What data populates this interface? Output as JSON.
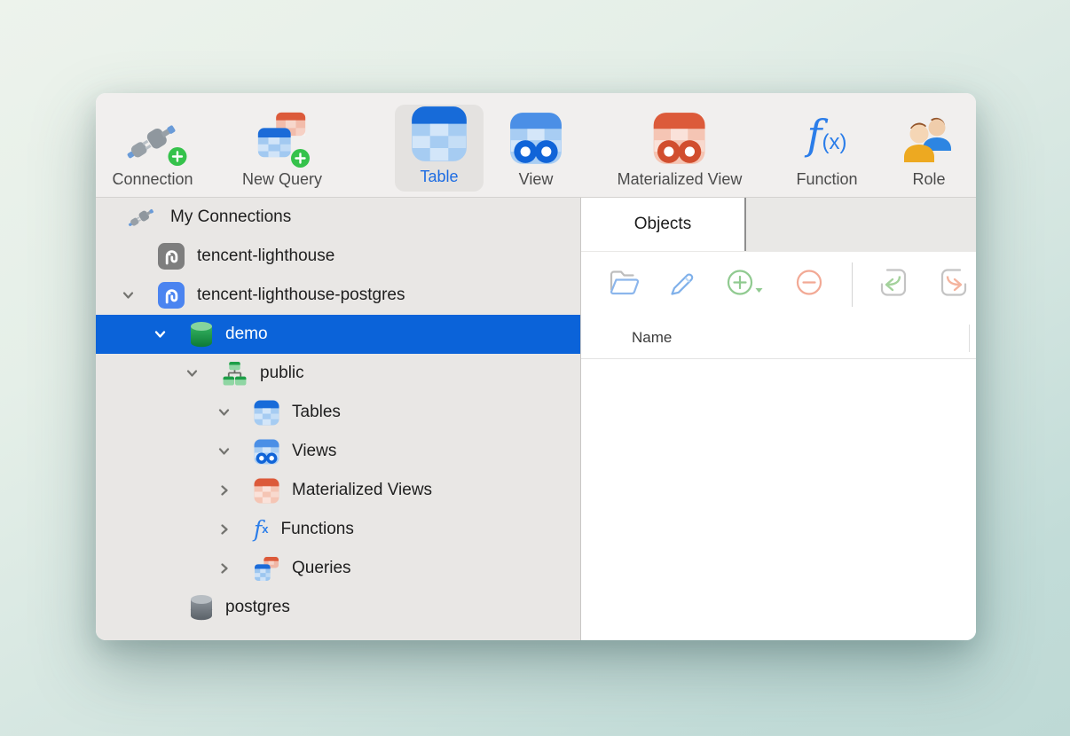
{
  "toolbar": {
    "items": [
      {
        "label": "Connection",
        "icon": "connection-plug-add"
      },
      {
        "label": "New Query",
        "icon": "new-query-add"
      },
      {
        "label": "Table",
        "icon": "table",
        "selected": true
      },
      {
        "label": "View",
        "icon": "view"
      },
      {
        "label": "Materialized View",
        "icon": "materialized-view"
      },
      {
        "label": "Function",
        "icon": "function-fx"
      },
      {
        "label": "Role",
        "icon": "role-users"
      }
    ]
  },
  "sidebar": {
    "tree": [
      {
        "label": "My Connections",
        "level": 0,
        "chevron": "none",
        "icon": "plug"
      },
      {
        "label": "tencent-lighthouse",
        "level": 1,
        "chevron": "none",
        "icon": "postgres-gray"
      },
      {
        "label": "tencent-lighthouse-postgres",
        "level": 1,
        "chevron": "down",
        "icon": "postgres-blue"
      },
      {
        "label": "demo",
        "level": 2,
        "chevron": "down",
        "icon": "database-green",
        "selected": true
      },
      {
        "label": "public",
        "level": 3,
        "chevron": "down",
        "icon": "schema"
      },
      {
        "label": "Tables",
        "level": 4,
        "chevron": "down",
        "icon": "table"
      },
      {
        "label": "Views",
        "level": 4,
        "chevron": "down",
        "icon": "view"
      },
      {
        "label": "Materialized Views",
        "level": 4,
        "chevron": "right",
        "icon": "materialized-view"
      },
      {
        "label": "Functions",
        "level": 4,
        "chevron": "right",
        "icon": "function"
      },
      {
        "label": "Queries",
        "level": 4,
        "chevron": "right",
        "icon": "query"
      },
      {
        "label": "postgres",
        "level": 2,
        "chevron": "none",
        "icon": "database-gray"
      }
    ]
  },
  "panel": {
    "tab_label": "Objects",
    "columns": [
      "Name"
    ],
    "toolbar_icons": [
      "open-folder",
      "design-pencil",
      "new-object-plus",
      "delete-minus",
      "import-wizard",
      "export-wizard"
    ]
  },
  "icons": {
    "fx_f": "f",
    "fx_sub": "x",
    "fx_paren": "(x)"
  },
  "colors": {
    "selection_blue": "#0b63d9",
    "accent_blue": "#1d6ce2",
    "toolbar_bg": "#f1efee",
    "sidebar_bg": "#e9e7e5",
    "green_badge": "#35c24b"
  }
}
